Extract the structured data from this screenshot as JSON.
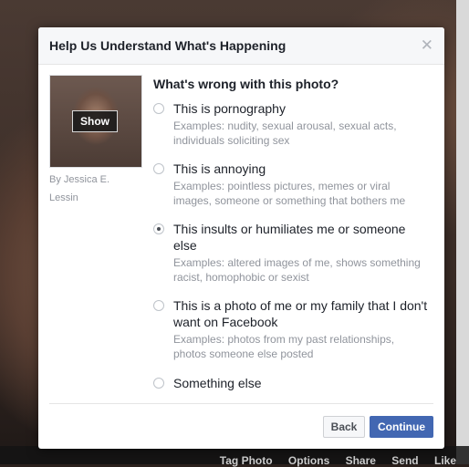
{
  "background": {
    "photo_actions": [
      "Tag Photo",
      "Options",
      "Share",
      "Send",
      "Like"
    ]
  },
  "dialog": {
    "title": "Help Us Understand What's Happening",
    "close_icon": "close-icon",
    "thumbnail": {
      "show_label": "Show",
      "byline": "By Jessica E. Lessin"
    },
    "question": "What's wrong with this photo?",
    "options": [
      {
        "label": "This is pornography",
        "description": "Examples: nudity, sexual arousal, sexual acts, individuals soliciting sex",
        "checked": false
      },
      {
        "label": "This is annoying",
        "description": "Examples: pointless pictures, memes or viral images, someone or something that bothers me",
        "checked": false
      },
      {
        "label": "This insults or humiliates me or someone else",
        "description": "Examples: altered images of me, shows something racist, homophobic or sexist",
        "checked": true
      },
      {
        "label": "This is a photo of me or my family that I don't want on Facebook",
        "description": "Examples: photos from my past relationships, photos someone else posted",
        "checked": false
      },
      {
        "label": "Something else",
        "description": "",
        "checked": false
      }
    ],
    "buttons": {
      "back": "Back",
      "continue": "Continue"
    }
  },
  "colors": {
    "primary_button": "#4267b2",
    "title_text": "#1d2129",
    "muted_text": "#90949c"
  }
}
